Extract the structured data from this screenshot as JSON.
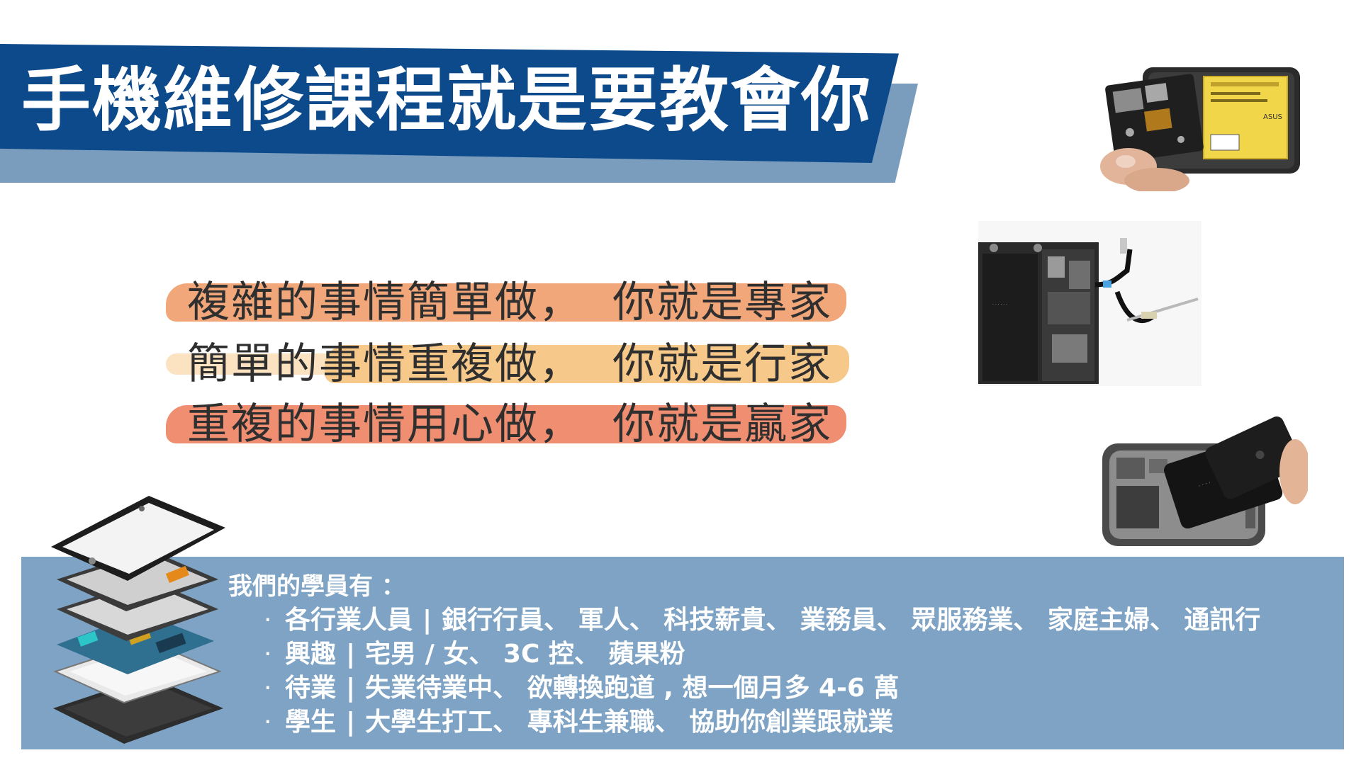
{
  "title": "手機維修課程就是要教會你",
  "slogans": [
    {
      "left": "複雜的事情簡單做，",
      "right": "你就是專家"
    },
    {
      "left": "簡單的事情重複做，",
      "right": "你就是行家"
    },
    {
      "left": "重複的事情用心做，",
      "right": "你就是贏家"
    }
  ],
  "students": {
    "heading": "我們的學員有 ：",
    "bullet": "·",
    "separator": "|",
    "rows": [
      {
        "category": "各行業人員",
        "items": "銀行行員、 軍人、 科技薪貴、 業務員、 眾服務業、 家庭主婦、 通訊行"
      },
      {
        "category": "興趣",
        "items": "宅男 / 女、 3C 控、 蘋果粉"
      },
      {
        "category": "待業",
        "items": "失業待業中、 欲轉換跑道 , 想一個月多 4-6 萬"
      },
      {
        "category": "學生",
        "items": "大學生打工、 專科生兼職、 協助你創業跟就業"
      }
    ]
  },
  "photos": {
    "photo1_brand": "ASUS"
  },
  "colors": {
    "banner_front": "#0d4a8b",
    "banner_back": "#7a9dbe",
    "panel": "#7ea3c5",
    "brush1": "#f2a77b",
    "brush2": "#f6c88a",
    "brush3": "#ef8e70"
  }
}
